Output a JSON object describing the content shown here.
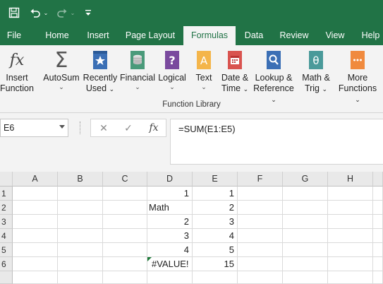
{
  "qat": {
    "save_icon": "save-icon",
    "undo_icon": "undo-icon",
    "redo_icon": "redo-icon",
    "customize_icon": "customize-qat-icon"
  },
  "tabs": [
    {
      "label": "File"
    },
    {
      "label": "Home"
    },
    {
      "label": "Insert"
    },
    {
      "label": "Page Layout"
    },
    {
      "label": "Formulas",
      "active": true
    },
    {
      "label": "Data"
    },
    {
      "label": "Review"
    },
    {
      "label": "View"
    },
    {
      "label": "Help"
    }
  ],
  "ribbon": {
    "group_label": "Function Library",
    "buttons": [
      {
        "line1": "Insert",
        "line2": "Function",
        "icon": "fx-icon"
      },
      {
        "line1": "AutoSum",
        "line2": "",
        "icon": "sigma-icon"
      },
      {
        "line1": "Recently",
        "line2": "Used",
        "icon": "star-book-icon"
      },
      {
        "line1": "Financial",
        "line2": "",
        "icon": "coins-book-icon"
      },
      {
        "line1": "Logical",
        "line2": "",
        "icon": "question-book-icon"
      },
      {
        "line1": "Text",
        "line2": "",
        "icon": "text-book-icon"
      },
      {
        "line1": "Date &",
        "line2": "Time",
        "icon": "calendar-book-icon"
      },
      {
        "line1": "Lookup &",
        "line2": "Reference",
        "icon": "magnifier-book-icon"
      },
      {
        "line1": "Math &",
        "line2": "Trig",
        "icon": "theta-book-icon"
      },
      {
        "line1": "More",
        "line2": "Functions",
        "icon": "more-book-icon"
      }
    ]
  },
  "formula_bar": {
    "name_box": "E6",
    "cancel_symbol": "✕",
    "enter_symbol": "✓",
    "fx_label": "fx",
    "formula": "=SUM(E1:E5)"
  },
  "sheet": {
    "columns": [
      "A",
      "B",
      "C",
      "D",
      "E",
      "F",
      "G",
      "H"
    ],
    "rows": [
      "1",
      "2",
      "3",
      "4",
      "5",
      "6"
    ],
    "cells": {
      "D1": "1",
      "E1": "1",
      "D2": "Math",
      "E2": "2",
      "D3": "2",
      "E3": "3",
      "D4": "3",
      "E4": "4",
      "D5": "4",
      "E5": "5",
      "D6": "#VALUE!",
      "E6": "15"
    }
  },
  "colors": {
    "accent": "#217346",
    "ribbon_bg": "#f3f3f3",
    "error_indicator": "#1e7b3a"
  }
}
